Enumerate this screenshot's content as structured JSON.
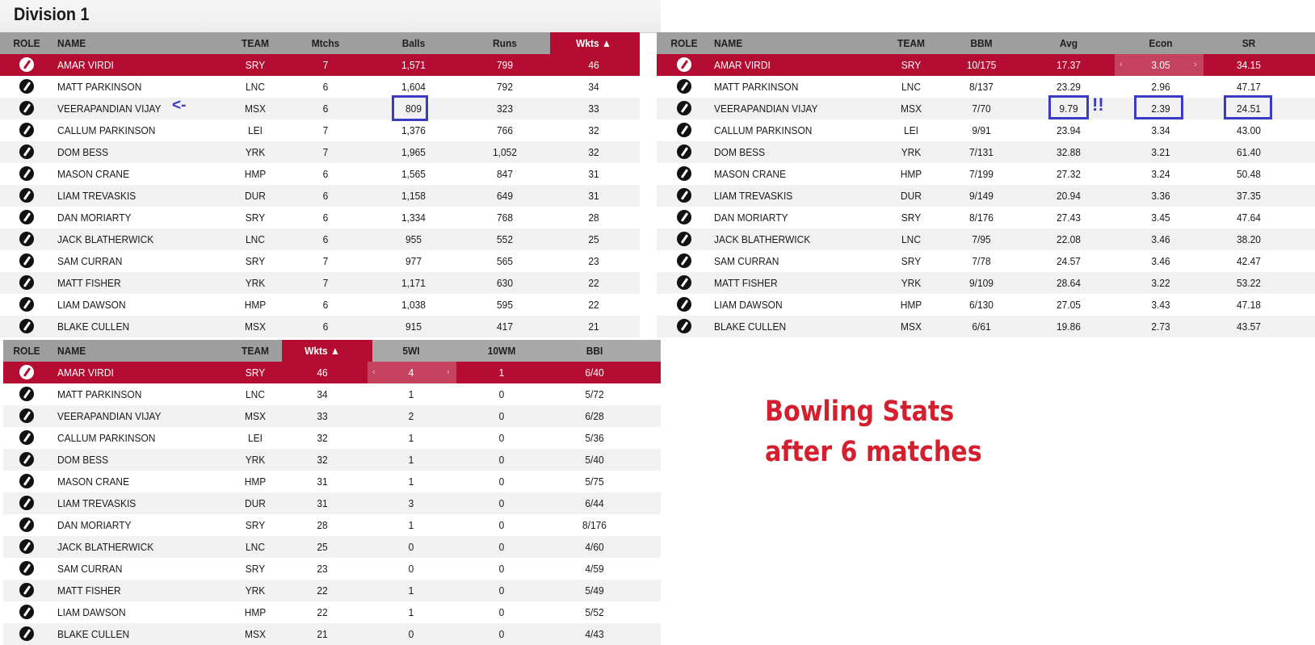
{
  "title": "Division 1",
  "annotation": {
    "line1": "Bowling Stats",
    "line2": "after 6 matches",
    "arrow": "<-",
    "exclaim": "!!"
  },
  "colors": {
    "highlight": "#b50d31",
    "header": "#9e9e9e",
    "annotation_red": "#d4202e",
    "annotation_blue": "#3a3ac4"
  },
  "table1": {
    "headers": [
      "ROLE",
      "NAME",
      "TEAM",
      "Mtchs",
      "Balls",
      "Runs",
      "Wkts ▲"
    ],
    "rows": [
      [
        "bowler-icon",
        "AMAR VIRDI",
        "SRY",
        "7",
        "1,571",
        "799",
        "46"
      ],
      [
        "bowler-icon",
        "MATT PARKINSON",
        "LNC",
        "6",
        "1,604",
        "792",
        "34"
      ],
      [
        "bowler-icon",
        "VEERAPANDIAN VIJAY",
        "MSX",
        "6",
        "809",
        "323",
        "33"
      ],
      [
        "bowler-icon",
        "CALLUM PARKINSON",
        "LEI",
        "7",
        "1,376",
        "766",
        "32"
      ],
      [
        "bowler-icon",
        "DOM BESS",
        "YRK",
        "7",
        "1,965",
        "1,052",
        "32"
      ],
      [
        "bowler-icon",
        "MASON CRANE",
        "HMP",
        "6",
        "1,565",
        "847",
        "31"
      ],
      [
        "bowler-icon",
        "LIAM TREVASKIS",
        "DUR",
        "6",
        "1,158",
        "649",
        "31"
      ],
      [
        "bowler-icon",
        "DAN MORIARTY",
        "SRY",
        "6",
        "1,334",
        "768",
        "28"
      ],
      [
        "bowler-icon",
        "JACK BLATHERWICK",
        "LNC",
        "6",
        "955",
        "552",
        "25"
      ],
      [
        "bowler-icon",
        "SAM CURRAN",
        "SRY",
        "7",
        "977",
        "565",
        "23"
      ],
      [
        "bowler-icon",
        "MATT FISHER",
        "YRK",
        "7",
        "1,171",
        "630",
        "22"
      ],
      [
        "bowler-icon",
        "LIAM DAWSON",
        "HMP",
        "6",
        "1,038",
        "595",
        "22"
      ],
      [
        "bowler-icon",
        "BLAKE CULLEN",
        "MSX",
        "6",
        "915",
        "417",
        "21"
      ]
    ]
  },
  "table2": {
    "headers": [
      "ROLE",
      "NAME",
      "TEAM",
      "BBM",
      "Avg",
      "Econ",
      "SR"
    ],
    "rows": [
      [
        "bowler-icon",
        "AMAR VIRDI",
        "SRY",
        "10/175",
        "17.37",
        "3.05",
        "34.15"
      ],
      [
        "bowler-icon",
        "MATT PARKINSON",
        "LNC",
        "8/137",
        "23.29",
        "2.96",
        "47.17"
      ],
      [
        "bowler-icon",
        "VEERAPANDIAN VIJAY",
        "MSX",
        "7/70",
        "9.79",
        "2.39",
        "24.51"
      ],
      [
        "bowler-icon",
        "CALLUM PARKINSON",
        "LEI",
        "9/91",
        "23.94",
        "3.34",
        "43.00"
      ],
      [
        "bowler-icon",
        "DOM BESS",
        "YRK",
        "7/131",
        "32.88",
        "3.21",
        "61.40"
      ],
      [
        "bowler-icon",
        "MASON CRANE",
        "HMP",
        "7/199",
        "27.32",
        "3.24",
        "50.48"
      ],
      [
        "bowler-icon",
        "LIAM TREVASKIS",
        "DUR",
        "9/149",
        "20.94",
        "3.36",
        "37.35"
      ],
      [
        "bowler-icon",
        "DAN MORIARTY",
        "SRY",
        "8/176",
        "27.43",
        "3.45",
        "47.64"
      ],
      [
        "bowler-icon",
        "JACK BLATHERWICK",
        "LNC",
        "7/95",
        "22.08",
        "3.46",
        "38.20"
      ],
      [
        "bowler-icon",
        "SAM CURRAN",
        "SRY",
        "7/78",
        "24.57",
        "3.46",
        "42.47"
      ],
      [
        "bowler-icon",
        "MATT FISHER",
        "YRK",
        "9/109",
        "28.64",
        "3.22",
        "53.22"
      ],
      [
        "bowler-icon",
        "LIAM DAWSON",
        "HMP",
        "6/130",
        "27.05",
        "3.43",
        "47.18"
      ],
      [
        "bowler-icon",
        "BLAKE CULLEN",
        "MSX",
        "6/61",
        "19.86",
        "2.73",
        "43.57"
      ]
    ]
  },
  "table3": {
    "headers": [
      "ROLE",
      "NAME",
      "TEAM",
      "Wkts ▲",
      "5WI",
      "10WM",
      "BBI"
    ],
    "rows": [
      [
        "bowler-icon",
        "AMAR VIRDI",
        "SRY",
        "46",
        "4",
        "1",
        "6/40"
      ],
      [
        "bowler-icon",
        "MATT PARKINSON",
        "LNC",
        "34",
        "1",
        "0",
        "5/72"
      ],
      [
        "bowler-icon",
        "VEERAPANDIAN VIJAY",
        "MSX",
        "33",
        "2",
        "0",
        "6/28"
      ],
      [
        "bowler-icon",
        "CALLUM PARKINSON",
        "LEI",
        "32",
        "1",
        "0",
        "5/36"
      ],
      [
        "bowler-icon",
        "DOM BESS",
        "YRK",
        "32",
        "1",
        "0",
        "5/40"
      ],
      [
        "bowler-icon",
        "MASON CRANE",
        "HMP",
        "31",
        "1",
        "0",
        "5/75"
      ],
      [
        "bowler-icon",
        "LIAM TREVASKIS",
        "DUR",
        "31",
        "3",
        "0",
        "6/44"
      ],
      [
        "bowler-icon",
        "DAN MORIARTY",
        "SRY",
        "28",
        "1",
        "0",
        "8/176"
      ],
      [
        "bowler-icon",
        "JACK BLATHERWICK",
        "LNC",
        "25",
        "0",
        "0",
        "4/60"
      ],
      [
        "bowler-icon",
        "SAM CURRAN",
        "SRY",
        "23",
        "0",
        "0",
        "4/59"
      ],
      [
        "bowler-icon",
        "MATT FISHER",
        "YRK",
        "22",
        "1",
        "0",
        "5/49"
      ],
      [
        "bowler-icon",
        "LIAM DAWSON",
        "HMP",
        "22",
        "1",
        "0",
        "5/52"
      ],
      [
        "bowler-icon",
        "BLAKE CULLEN",
        "MSX",
        "21",
        "0",
        "0",
        "4/43"
      ]
    ]
  }
}
